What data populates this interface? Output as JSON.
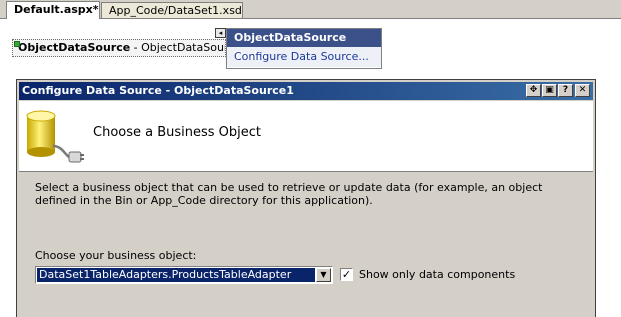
{
  "tabs": [
    {
      "label": "Default.aspx*",
      "active": true
    },
    {
      "label": "App_Code/DataSet1.xsd",
      "active": false
    }
  ],
  "design": {
    "control_type": "ObjectDataSource",
    "control_id": " - ObjectDataSource1",
    "smart_tag_glyph": "◂"
  },
  "tasks_panel": {
    "title": "ObjectDataSource Tasks",
    "link": "Configure Data Source..."
  },
  "dialog": {
    "title": "Configure Data Source - ObjectDataSource1",
    "buttons": {
      "move": "✥",
      "restore": "▣",
      "help": "?",
      "close": "✕"
    },
    "heading": "Choose a Business Object",
    "icon": "database-plug-icon",
    "description": "Select a business object that can be used to retrieve or update data (for example, an object defined in the Bin or App_Code directory for this application).",
    "choose_label": "Choose your business object:",
    "selected_object": "DataSet1TableAdapters.ProductsTableAdapter",
    "combo_arrow": "▼",
    "checkbox_label": "Show only data components",
    "checkbox_checked": true,
    "checkbox_mark": "✓"
  },
  "colors": {
    "titlebar": "#0a246a",
    "tasks_header": "#3c5089",
    "selection": "#0a246a",
    "dialog_face": "#d4d0c8"
  }
}
